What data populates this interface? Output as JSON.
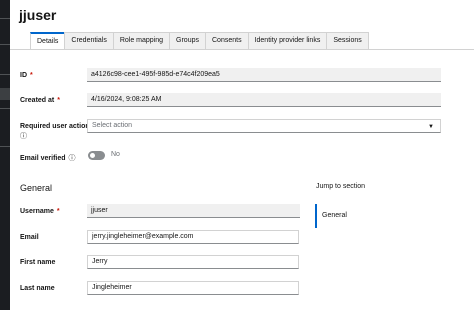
{
  "page": {
    "title": "jjuser"
  },
  "tabs": [
    "Details",
    "Credentials",
    "Role mapping",
    "Groups",
    "Consents",
    "Identity provider links",
    "Sessions"
  ],
  "active_tab": "Details",
  "fields": {
    "id": {
      "label": "ID",
      "required_mark": "*",
      "value": "a4126c98-cee1-495f-985d-e74c4f209ea5"
    },
    "created_at": {
      "label": "Created at",
      "required_mark": "*",
      "value": "4/16/2024, 9:08:25 AM"
    },
    "required_actions": {
      "label": "Required user actions",
      "placeholder": "Select action"
    },
    "email_verified": {
      "label": "Email verified",
      "toggle_text": "No",
      "checked": false
    }
  },
  "general": {
    "title": "General",
    "username": {
      "label": "Username",
      "required_mark": "*",
      "value": "jjuser"
    },
    "email": {
      "label": "Email",
      "value": "jerry.jingleheimer@example.com"
    },
    "first_name": {
      "label": "First name",
      "value": "Jerry"
    },
    "last_name": {
      "label": "Last name",
      "value": "Jingleheimer"
    }
  },
  "jump": {
    "title": "Jump to section",
    "items": [
      "General"
    ]
  },
  "icons": {
    "help": "help-circle-icon",
    "dropdown": "caret-down-icon"
  },
  "colors": {
    "accent": "#0066cc",
    "required": "#c9190b",
    "sidebar": "#1b1d21"
  }
}
